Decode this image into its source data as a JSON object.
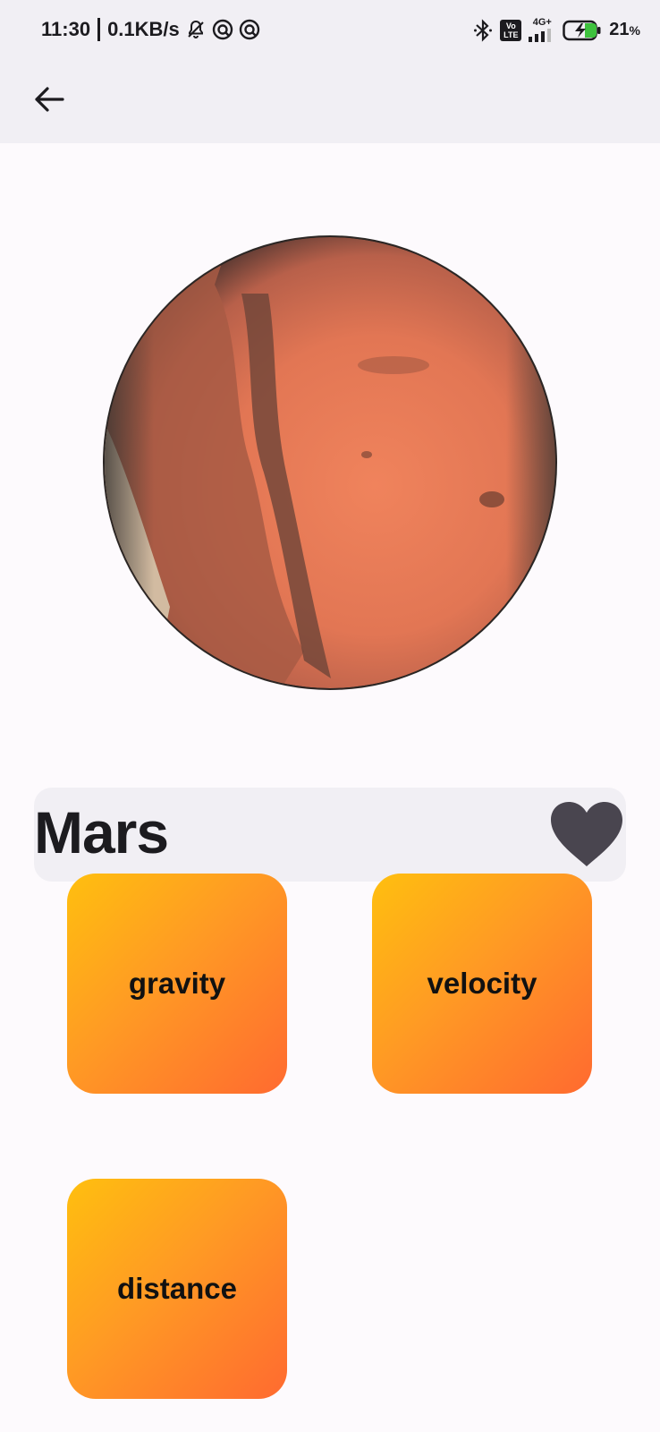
{
  "status_bar": {
    "time": "11:30",
    "network_speed": "0.1KB/s",
    "network_type": "4G+",
    "volte_label": "Vo LTE",
    "battery": "21",
    "battery_unit": "%",
    "icons": [
      "mute-notifications-icon",
      "app-icon",
      "app-icon",
      "bluetooth-icon",
      "volte-icon",
      "signal-icon",
      "battery-charging-icon"
    ]
  },
  "app_bar": {
    "back_icon": "arrow-left-icon"
  },
  "planet": {
    "name": "Mars",
    "favorite_icon": "heart-icon",
    "colors": {
      "surface": "#e07a55",
      "dark": "#7a4a38",
      "ice": "#d8d4c0"
    }
  },
  "tiles": [
    {
      "label": "gravity"
    },
    {
      "label": "velocity"
    },
    {
      "label": "distance"
    }
  ]
}
